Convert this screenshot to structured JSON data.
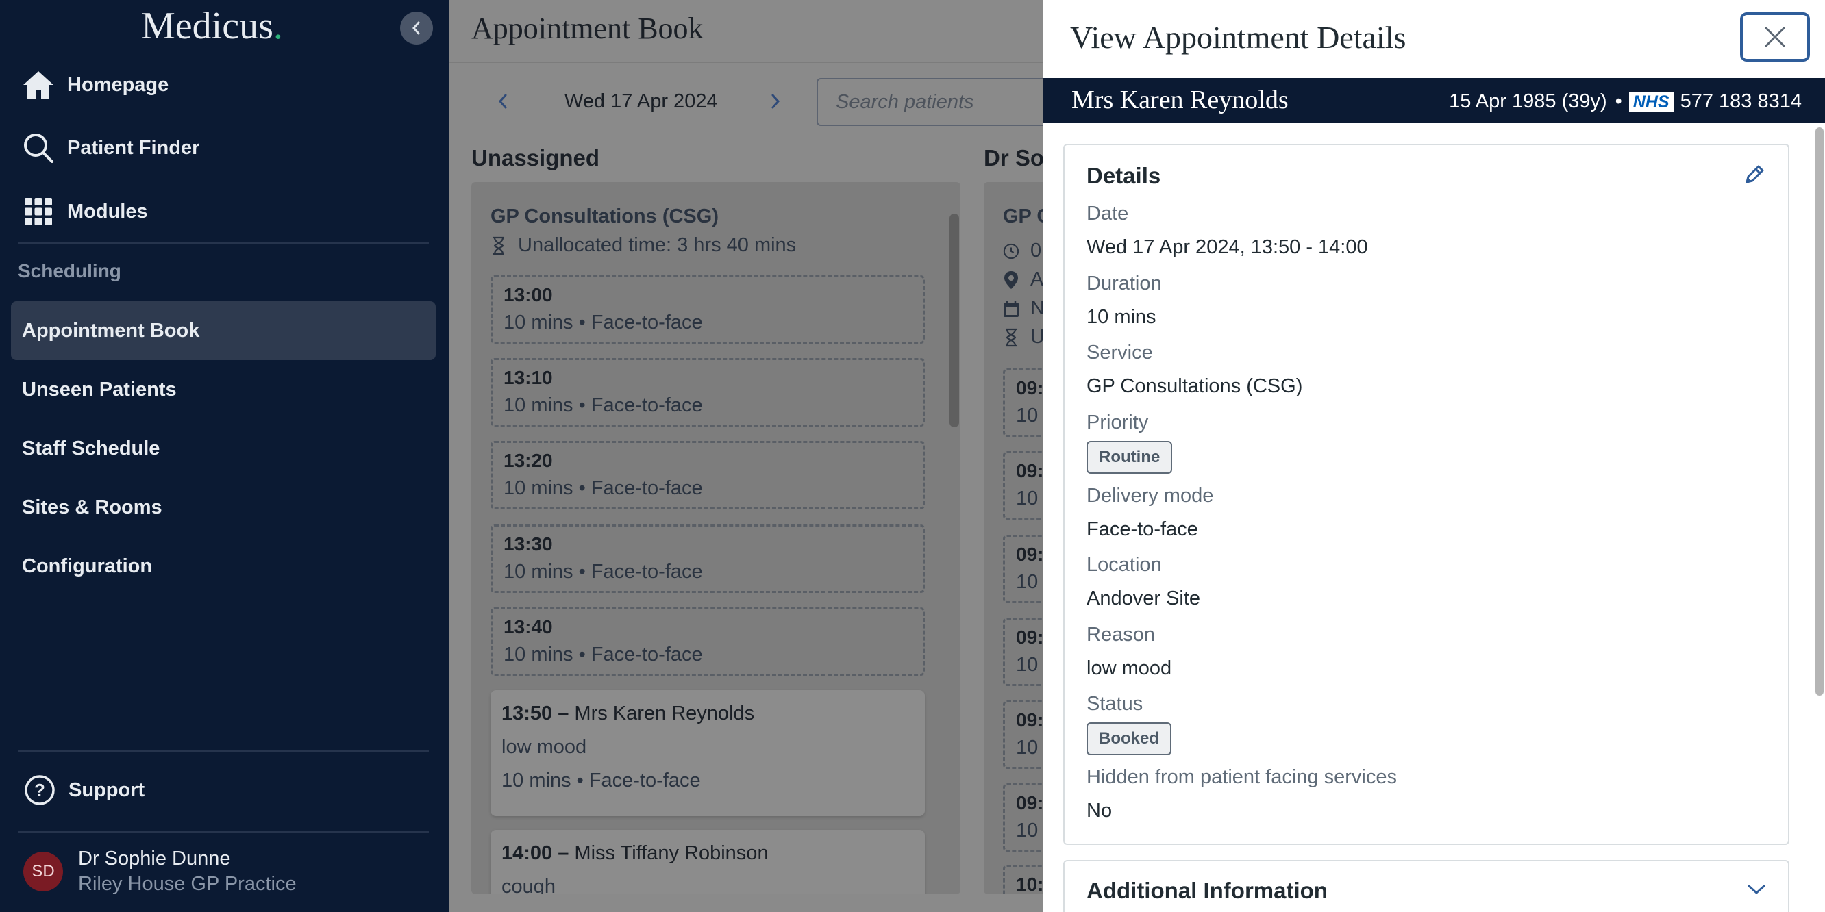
{
  "app": {
    "logo_text": "Medicus",
    "logo_dot": ".",
    "accent_color": "#2db37a",
    "sidebar_bg": "#0b1a33"
  },
  "sidebar": {
    "main_nav": [
      {
        "label": "Homepage",
        "icon": "home-icon"
      },
      {
        "label": "Patient Finder",
        "icon": "search-icon"
      },
      {
        "label": "Modules",
        "icon": "grid-icon"
      }
    ],
    "section_label": "Scheduling",
    "sub_nav": [
      {
        "label": "Appointment Book",
        "active": true
      },
      {
        "label": "Unseen Patients",
        "active": false
      },
      {
        "label": "Staff Schedule",
        "active": false
      },
      {
        "label": "Sites & Rooms",
        "active": false
      },
      {
        "label": "Configuration",
        "active": false
      }
    ],
    "support_label": "Support",
    "user": {
      "initials": "SD",
      "name": "Dr Sophie Dunne",
      "practice": "Riley House GP Practice"
    }
  },
  "main": {
    "title": "Appointment Book",
    "date": "Wed 17 Apr 2024",
    "search_placeholder": "Search patients",
    "unassigned": {
      "title": "Unassigned",
      "service": "GP Consultations (CSG)",
      "unallocated": "Unallocated time: 3 hrs 40 mins",
      "slots": [
        {
          "time": "13:00",
          "detail": "10 mins • Face-to-face"
        },
        {
          "time": "13:10",
          "detail": "10 mins • Face-to-face"
        },
        {
          "time": "13:20",
          "detail": "10 mins • Face-to-face"
        },
        {
          "time": "13:30",
          "detail": "10 mins • Face-to-face"
        },
        {
          "time": "13:40",
          "detail": "10 mins • Face-to-face"
        }
      ],
      "booked": [
        {
          "time": "13:50 –",
          "patient": "Mrs Karen Reynolds",
          "reason": "low mood",
          "detail": "10 mins • Face-to-face"
        },
        {
          "time": "14:00 –",
          "patient": "Miss Tiffany Robinson",
          "reason": "cough",
          "detail": ""
        }
      ]
    },
    "second_column": {
      "title_partial": "Dr So",
      "service_partial": "GP C",
      "meta_partial": [
        "0",
        "A",
        "N",
        "U"
      ],
      "slot_times_partial": [
        "09:",
        "09:",
        "09:",
        "09:",
        "09:",
        "09:",
        "10:"
      ],
      "slot_detail_partial": "10"
    }
  },
  "drawer": {
    "title": "View Appointment Details",
    "patient": {
      "name": "Mrs Karen Reynolds",
      "dob": "15 Apr 1985 (39y)",
      "separator": "•",
      "nhs_logo": "NHS",
      "nhs_number": "577 183 8314"
    },
    "details": {
      "title": "Details",
      "fields": {
        "date": {
          "label": "Date",
          "value": "Wed 17 Apr 2024, 13:50 - 14:00"
        },
        "duration": {
          "label": "Duration",
          "value": "10 mins"
        },
        "service": {
          "label": "Service",
          "value": "GP Consultations (CSG)"
        },
        "priority": {
          "label": "Priority",
          "value": "Routine"
        },
        "delivery_mode": {
          "label": "Delivery mode",
          "value": "Face-to-face"
        },
        "location": {
          "label": "Location",
          "value": "Andover Site"
        },
        "reason": {
          "label": "Reason",
          "value": "low mood"
        },
        "status": {
          "label": "Status",
          "value": "Booked"
        },
        "hidden": {
          "label": "Hidden from patient facing services",
          "value": "No"
        }
      }
    },
    "additional": {
      "title": "Additional Information"
    }
  }
}
